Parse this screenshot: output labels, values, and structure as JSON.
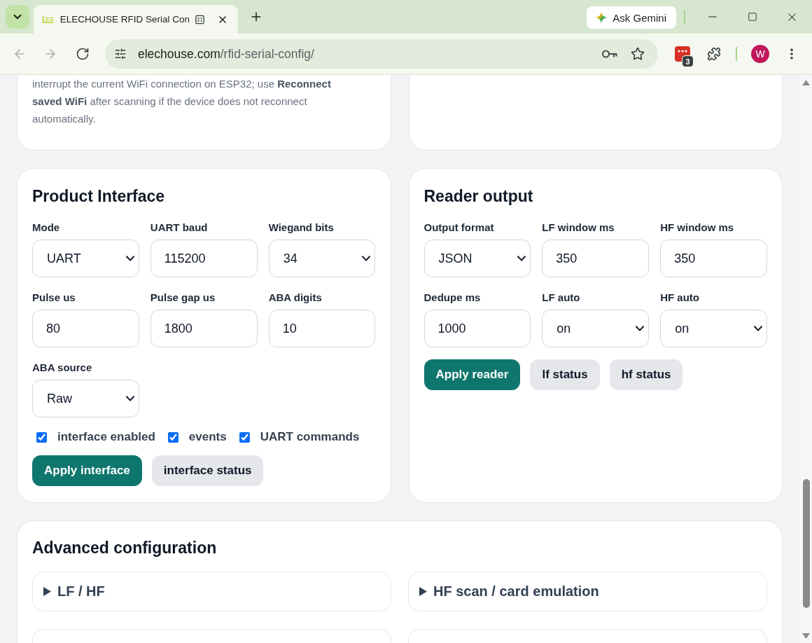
{
  "browser": {
    "tabs": [
      {
        "title": "ELECHOUSE RFID Serial Con",
        "selected": true
      }
    ],
    "gemini_button": "Ask Gemini",
    "nav": [
      {
        "kind": "back",
        "disabled": true
      },
      {
        "kind": "forward",
        "disabled": true
      },
      {
        "kind": "reload",
        "disabled": false
      }
    ],
    "address": {
      "host": "elechouse.com",
      "path": "/rfid-serial-config/"
    },
    "extension_badge": "3",
    "profile_initial": "W"
  },
  "notice": "interrupt the current WiFi connection on ESP32; use **Reconnect saved WiFi** after scanning if the device does not reconnect automatically.",
  "product_interface": {
    "title": "Product Interface",
    "fields": [
      {
        "label": "Mode",
        "kind": "select",
        "value": "UART"
      },
      {
        "label": "UART baud",
        "kind": "input",
        "value": "115200"
      },
      {
        "label": "Wiegand bits",
        "kind": "select",
        "value": "34"
      },
      {
        "label": "Pulse us",
        "kind": "input",
        "value": "80"
      },
      {
        "label": "Pulse gap us",
        "kind": "input",
        "value": "1800"
      },
      {
        "label": "ABA digits",
        "kind": "input",
        "value": "10"
      },
      {
        "label": "ABA source",
        "kind": "select",
        "value": "Raw"
      }
    ],
    "toggles": [
      {
        "label": "interface enabled",
        "checked": true
      },
      {
        "label": "events",
        "checked": true
      },
      {
        "label": "UART commands",
        "checked": true
      }
    ],
    "buttons": [
      {
        "label": "Apply interface",
        "kind": "primary"
      },
      {
        "label": "interface status",
        "kind": "secondary"
      }
    ]
  },
  "reader_output": {
    "title": "Reader output",
    "fields": [
      {
        "label": "Output format",
        "kind": "select",
        "value": "JSON"
      },
      {
        "label": "LF window ms",
        "kind": "input",
        "value": "350"
      },
      {
        "label": "HF window ms",
        "kind": "input",
        "value": "350"
      },
      {
        "label": "Dedupe ms",
        "kind": "input",
        "value": "1000"
      },
      {
        "label": "LF auto",
        "kind": "select",
        "value": "on"
      },
      {
        "label": "HF auto",
        "kind": "select",
        "value": "on"
      }
    ],
    "buttons": [
      {
        "label": "Apply reader",
        "kind": "primary"
      },
      {
        "label": "lf status",
        "kind": "secondary"
      },
      {
        "label": "hf status",
        "kind": "secondary"
      }
    ]
  },
  "advanced": {
    "title": "Advanced configuration",
    "sections": [
      {
        "kind": "summary",
        "title": "LF / HF",
        "expanded": false
      },
      {
        "kind": "summary",
        "title": "HF scan / card emulation",
        "expanded": false
      },
      {
        "kind": "clipped"
      },
      {
        "kind": "clipped"
      }
    ]
  }
}
